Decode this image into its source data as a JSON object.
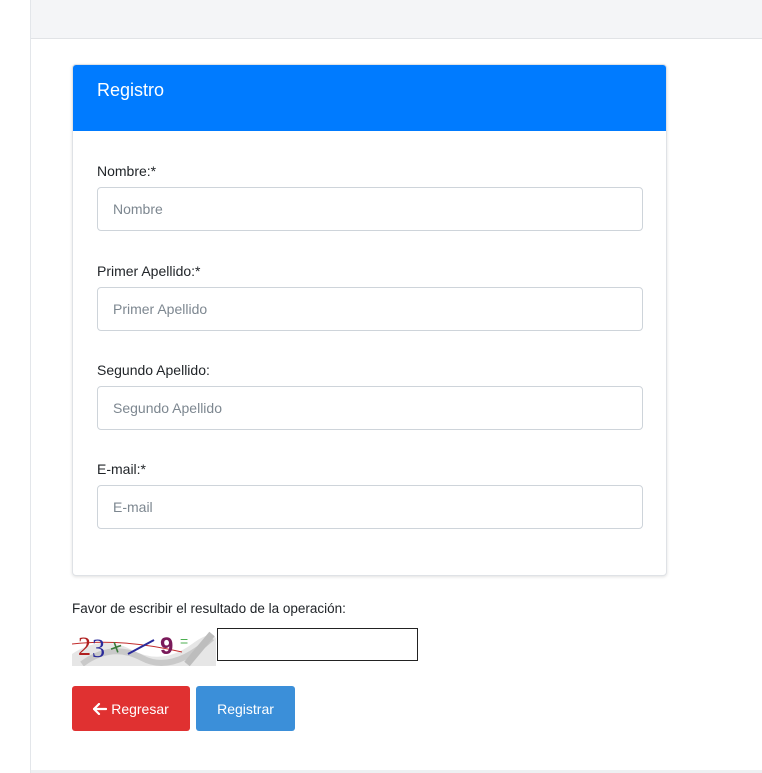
{
  "card": {
    "title": "Registro"
  },
  "form": {
    "fields": [
      {
        "label": "Nombre:*",
        "placeholder": "Nombre",
        "value": ""
      },
      {
        "label": "Primer Apellido:*",
        "placeholder": "Primer Apellido",
        "value": ""
      },
      {
        "label": "Segundo Apellido:",
        "placeholder": "Segundo Apellido",
        "value": ""
      },
      {
        "label": "E-mail:*",
        "placeholder": "E-mail",
        "value": ""
      }
    ]
  },
  "captcha": {
    "label": "Favor de escribir el resultado de la operación:",
    "image_text": "23+9=",
    "value": ""
  },
  "buttons": {
    "back_label": "Regresar",
    "back_icon": "arrow-left-icon",
    "register_label": "Registrar"
  },
  "colors": {
    "header": "#007bff",
    "back_button": "#e03131",
    "register_button": "#3b8fd9"
  }
}
